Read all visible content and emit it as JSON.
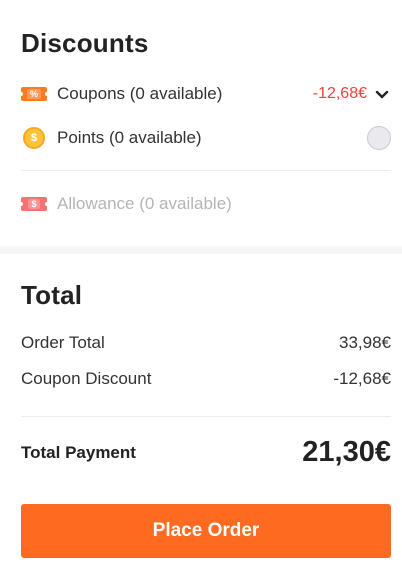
{
  "discounts": {
    "title": "Discounts",
    "coupons": {
      "icon": "coupon-percent-icon",
      "icon_glyph": "%",
      "label": "Coupons (0 available)",
      "amount": "-12,68€"
    },
    "points": {
      "icon": "coin-icon",
      "icon_glyph": "$",
      "label": "Points (0 available)"
    },
    "allowance": {
      "icon": "allowance-dollar-icon",
      "icon_glyph": "$",
      "label": "Allowance (0 available)"
    }
  },
  "total": {
    "title": "Total",
    "order_total_label": "Order Total",
    "order_total_value": "33,98€",
    "coupon_discount_label": "Coupon Discount",
    "coupon_discount_value": "-12,68€",
    "payment_label": "Total Payment",
    "payment_value": "21,30€"
  },
  "place_order": {
    "label": "Place Order"
  },
  "colors": {
    "accent": "#ff6a21",
    "discount_red": "#f0413b",
    "coin_yellow": "#fdc43a"
  }
}
